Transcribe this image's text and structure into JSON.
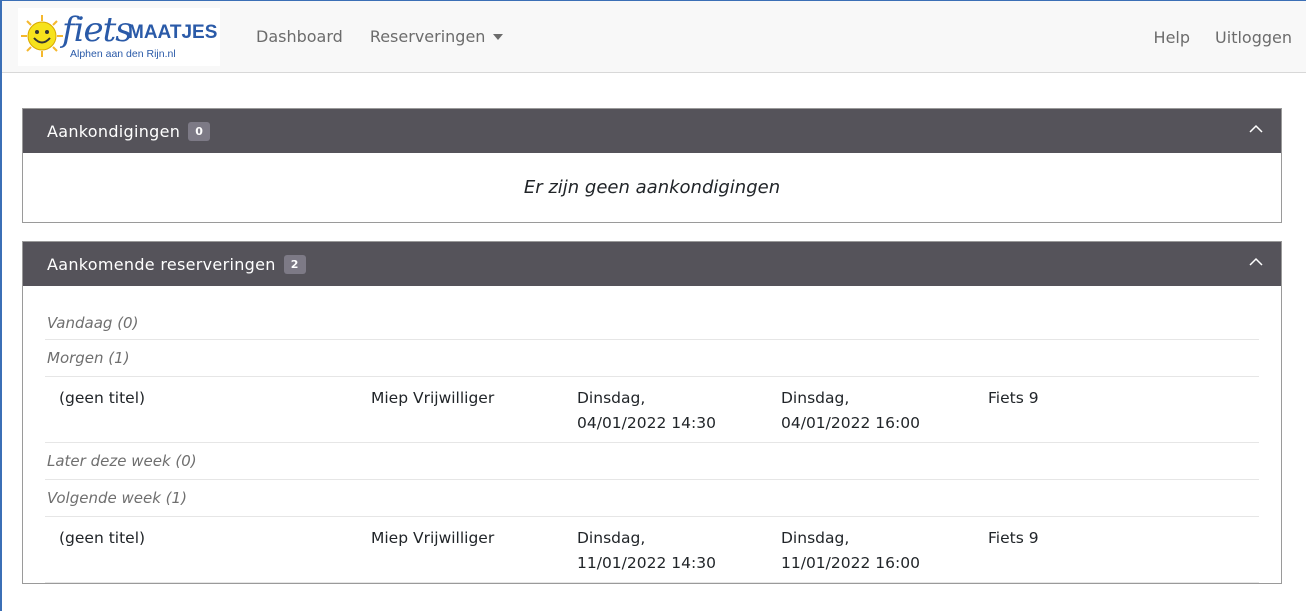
{
  "brand": {
    "word": "fiets",
    "caps": "MAATJES",
    "sub": "Alphen aan den Rijn.nl"
  },
  "nav": {
    "dashboard": "Dashboard",
    "reserveringen": "Reserveringen",
    "help": "Help",
    "logout": "Uitloggen"
  },
  "announcements": {
    "title": "Aankondigingen",
    "count": "0",
    "empty": "Er zijn geen aankondigingen"
  },
  "upcoming": {
    "title": "Aankomende reserveringen",
    "count": "2",
    "groups": {
      "today": "Vandaag (0)",
      "tomorrow": "Morgen (1)",
      "later": "Later deze week (0)",
      "nextweek": "Volgende week (1)"
    },
    "rows": [
      {
        "title": "(geen titel)",
        "name": "Miep Vrijwilliger",
        "start_day": "Dinsdag,",
        "start_time": "04/01/2022 14:30",
        "end_day": "Dinsdag,",
        "end_time": "04/01/2022 16:00",
        "bike": "Fiets 9"
      },
      {
        "title": "(geen titel)",
        "name": "Miep Vrijwilliger",
        "start_day": "Dinsdag,",
        "start_time": "11/01/2022 14:30",
        "end_day": "Dinsdag,",
        "end_time": "11/01/2022 16:00",
        "bike": "Fiets 9"
      }
    ]
  },
  "colors": {
    "header_bg": "#55535a",
    "badge_bg": "#7d7a86",
    "brand_blue": "#2a5aa8"
  },
  "icons": {
    "collapse": "chevron-up-icon",
    "dropdown": "caret-down-icon",
    "logo": "smiley-sun-icon"
  }
}
